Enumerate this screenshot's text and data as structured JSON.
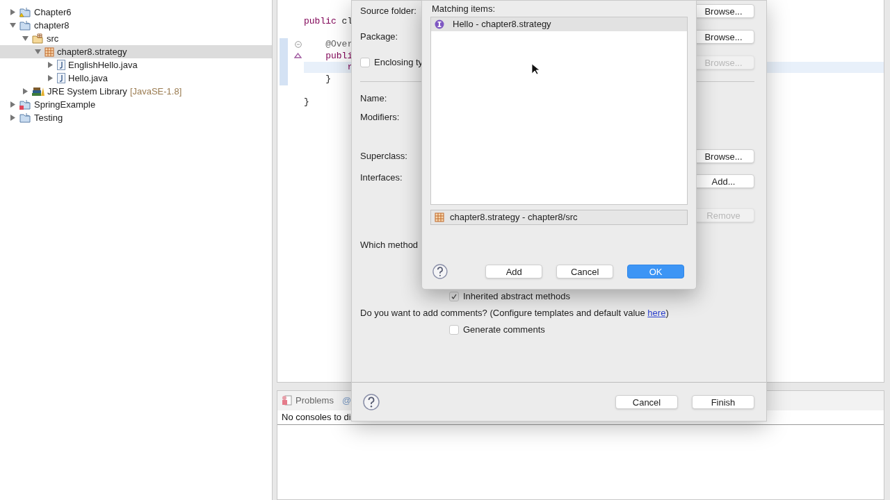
{
  "project_tree": [
    {
      "label": "Chapter6",
      "kind": "project-warning",
      "expanded": false,
      "selected": false
    },
    {
      "label": "chapter8",
      "kind": "project",
      "expanded": true,
      "selected": false,
      "children": [
        {
          "label": "src",
          "kind": "source-folder",
          "expanded": true,
          "selected": false,
          "children": [
            {
              "label": "chapter8.strategy",
              "kind": "package",
              "expanded": true,
              "selected": true,
              "children": [
                {
                  "label": "EnglishHello.java",
                  "kind": "java-file",
                  "expanded": false,
                  "selected": false
                },
                {
                  "label": "Hello.java",
                  "kind": "java-file",
                  "expanded": false,
                  "selected": false
                }
              ]
            }
          ]
        },
        {
          "label": "JRE System Library",
          "suffix": "[JavaSE-1.8]",
          "kind": "library",
          "expanded": false,
          "selected": false
        }
      ]
    },
    {
      "label": "SpringExample",
      "kind": "project-error",
      "expanded": false,
      "selected": false
    },
    {
      "label": "Testing",
      "kind": "project",
      "expanded": false,
      "selected": false
    }
  ],
  "editor": {
    "lines": [
      {
        "kind": "plain",
        "current": false,
        "parts": [
          {
            "text": "public",
            "kind": "keyword"
          },
          {
            "text": " cl",
            "kind": "plain"
          }
        ]
      },
      {
        "kind": "blank",
        "current": false
      },
      {
        "kind": "fold",
        "current": false,
        "parts": [
          {
            "text": "    @Over",
            "kind": "annotation"
          }
        ]
      },
      {
        "kind": "override",
        "current": false,
        "parts": [
          {
            "text": "    publi",
            "kind": "keyword"
          }
        ]
      },
      {
        "kind": "plain",
        "current": true,
        "parts": [
          {
            "text": "        r",
            "kind": "keyword"
          }
        ]
      },
      {
        "kind": "plain",
        "current": false,
        "parts": [
          {
            "text": "    }",
            "kind": "plain"
          }
        ]
      },
      {
        "kind": "blank",
        "current": false
      },
      {
        "kind": "plain",
        "current": false,
        "parts": [
          {
            "text": "}",
            "kind": "plain"
          }
        ]
      }
    ]
  },
  "bottom_panel": {
    "tab": "Problems",
    "tab_2": "@",
    "message": "No consoles to di"
  },
  "new_class_dialog": {
    "source_folder_label": "Source folder:",
    "source_browse": {
      "label": "Browse...",
      "disabled": false
    },
    "package_label": "Package:",
    "package_browse": {
      "label": "Browse...",
      "disabled": false
    },
    "enclosing": {
      "label": "Enclosing ty",
      "checked": false
    },
    "enclosing_browse": {
      "label": "Browse...",
      "disabled": true
    },
    "name_label": "Name:",
    "modifiers_label": "Modifiers:",
    "superclass_label": "Superclass:",
    "superclass_browse": {
      "label": "Browse...",
      "disabled": false
    },
    "interfaces_label": "Interfaces:",
    "interfaces_add": {
      "label": "Add...",
      "disabled": false
    },
    "interfaces_remove": {
      "label": "Remove",
      "disabled": true
    },
    "methods_label": "Which method",
    "inherited": {
      "label": "Inherited abstract methods",
      "checked": true
    },
    "comments_text": "Do you want to add comments? (Configure templates and default value ",
    "comments_link": "here",
    "comments_end": ")",
    "generate": {
      "label": "Generate comments",
      "checked": false
    },
    "buttons": [
      {
        "label": "Cancel",
        "default": false
      },
      {
        "label": "Finish",
        "default": false
      }
    ]
  },
  "interface_picker": {
    "matching_label": "Matching items:",
    "items": [
      {
        "label": "Hello - chapter8.strategy",
        "selected": true
      }
    ],
    "qualifier": "chapter8.strategy - chapter8/src",
    "buttons": [
      {
        "label": "Add",
        "default": false
      },
      {
        "label": "Cancel",
        "default": false
      },
      {
        "label": "OK",
        "default": true
      }
    ]
  }
}
